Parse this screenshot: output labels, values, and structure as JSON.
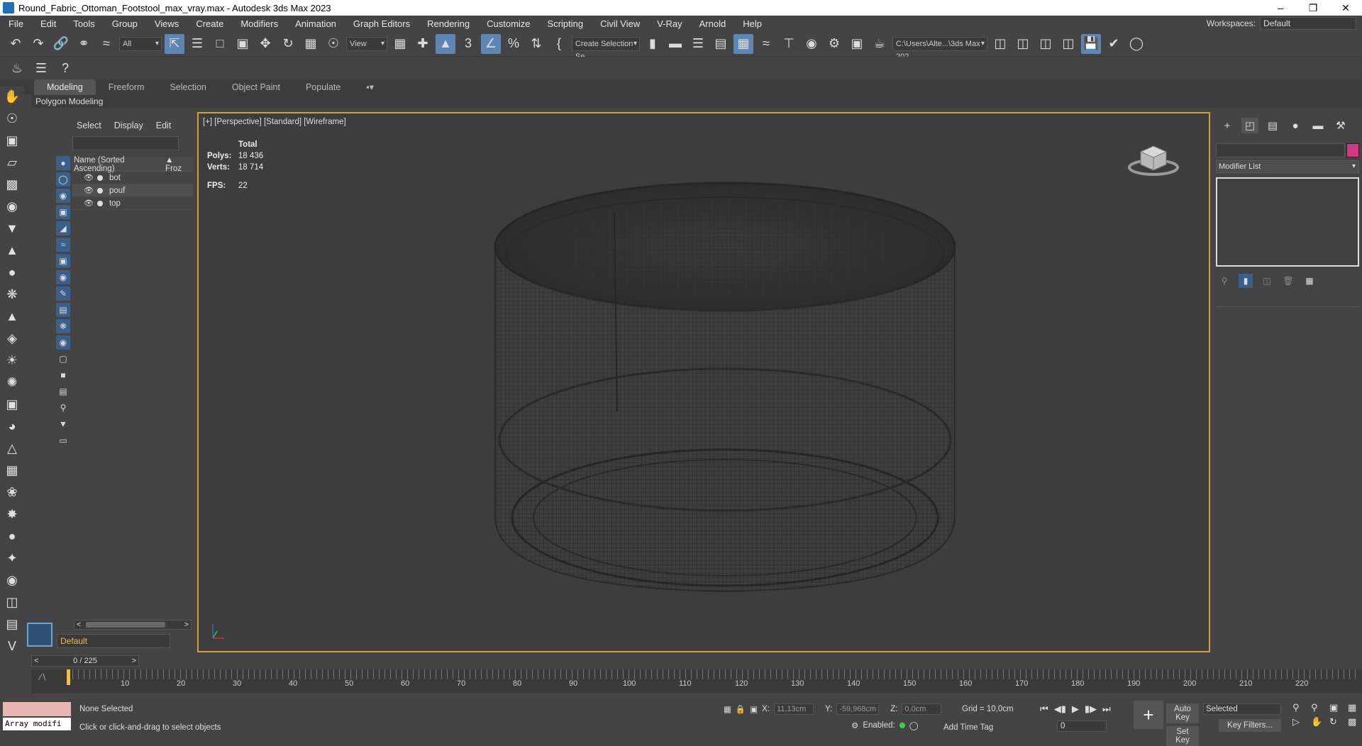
{
  "titlebar": {
    "title": "Round_Fabric_Ottoman_Footstool_max_vray.max - Autodesk 3ds Max 2023",
    "minimize": "–",
    "restore": "❐",
    "close": "✕"
  },
  "menu": [
    "File",
    "Edit",
    "Tools",
    "Group",
    "Views",
    "Create",
    "Modifiers",
    "Animation",
    "Graph Editors",
    "Rendering",
    "Customize",
    "Scripting",
    "Civil View",
    "V-Ray",
    "Arnold",
    "Help"
  ],
  "workspaces": {
    "label": "Workspaces:",
    "value": "Default"
  },
  "toolbar": {
    "filter_value": "All",
    "refcoord_value": "View",
    "selset_value": "Create Selection Se",
    "project_path": "C:\\Users\\Alte...\\3ds Max 202"
  },
  "ribbon": {
    "tabs": [
      "Modeling",
      "Freeform",
      "Selection",
      "Object Paint",
      "Populate"
    ],
    "active_tab": "Modeling",
    "sub_label": "Polygon Modeling"
  },
  "explorer": {
    "tabs": [
      "Select",
      "Display",
      "Edit"
    ],
    "column_name": "Name (Sorted Ascending)",
    "column_frozen": "▲ Froz",
    "items": [
      {
        "name": "bot"
      },
      {
        "name": "pouf"
      },
      {
        "name": "top"
      }
    ],
    "layer": "Default"
  },
  "viewport": {
    "label": "[+] [Perspective] [Standard] [Wireframe]",
    "stats": {
      "total_label": "Total",
      "polys_label": "Polys:",
      "polys": "18 436",
      "verts_label": "Verts:",
      "verts": "18 714",
      "fps_label": "FPS:",
      "fps": "22"
    }
  },
  "command_panel": {
    "modifier_list": "Modifier List",
    "object_color": "#d23b84"
  },
  "timeline": {
    "frame_display": "0 / 225",
    "ticks": [
      "10",
      "20",
      "30",
      "40",
      "50",
      "60",
      "70",
      "80",
      "90",
      "100",
      "110",
      "120",
      "130",
      "140",
      "150",
      "160",
      "170",
      "180",
      "190",
      "200",
      "210",
      "220"
    ]
  },
  "status": {
    "maxscript_value": "Array modifi",
    "selection": "None Selected",
    "prompt": "Click or click-and-drag to select objects",
    "x_label": "X:",
    "x_value": "11,13cm",
    "y_label": "Y:",
    "y_value": "-59,968cm",
    "z_label": "Z:",
    "z_value": "0,0cm",
    "grid": "Grid = 10,0cm",
    "enabled": "Enabled:",
    "add_time_tag": "Add Time Tag",
    "auto_key": "Auto Key",
    "set_key": "Set Key",
    "selected": "Selected",
    "key_filters": "Key Filters...",
    "current_frame": "0"
  },
  "colors": {
    "viewport_border": "#c9a53f",
    "active_blue": "#5e86b5"
  }
}
